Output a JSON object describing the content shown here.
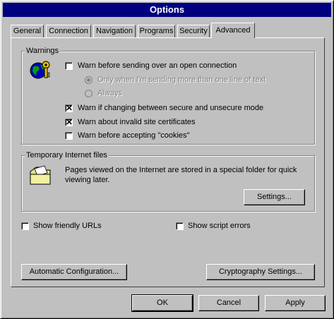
{
  "window": {
    "title": "Options"
  },
  "tabs": [
    {
      "label": "General"
    },
    {
      "label": "Connection"
    },
    {
      "label": "Navigation"
    },
    {
      "label": "Programs"
    },
    {
      "label": "Security"
    },
    {
      "label": "Advanced",
      "active": true
    }
  ],
  "warnings": {
    "group_label": "Warnings",
    "icon": "security-globe-key-icon",
    "items": [
      {
        "label": "Warn before sending over an open connection",
        "checked": false
      },
      {
        "label": "Only when I'm sending  more than one line of text",
        "selected": true,
        "disabled": true
      },
      {
        "label": "Always",
        "selected": false,
        "disabled": true
      },
      {
        "label": "Warn if changing between secure and unsecure mode",
        "checked": true
      },
      {
        "label": "Warn about invalid site certificates",
        "checked": true
      },
      {
        "label": "Warn before accepting \"cookies\"",
        "checked": false
      }
    ]
  },
  "temp_files": {
    "group_label": "Temporary Internet files",
    "icon": "folder-icon",
    "description": "Pages viewed on the Internet are stored in a special folder for quick viewing later.",
    "settings_button": "Settings..."
  },
  "options": {
    "friendly_urls": {
      "label": "Show friendly URLs",
      "checked": false
    },
    "script_errors": {
      "label": "Show script errors",
      "checked": false
    }
  },
  "buttons": {
    "auto_config": "Automatic Configuration...",
    "crypto": "Cryptography Settings...",
    "ok": "OK",
    "cancel": "Cancel",
    "apply": "Apply"
  },
  "colors": {
    "titlebar": "#000080",
    "face": "#c0c0c0"
  }
}
